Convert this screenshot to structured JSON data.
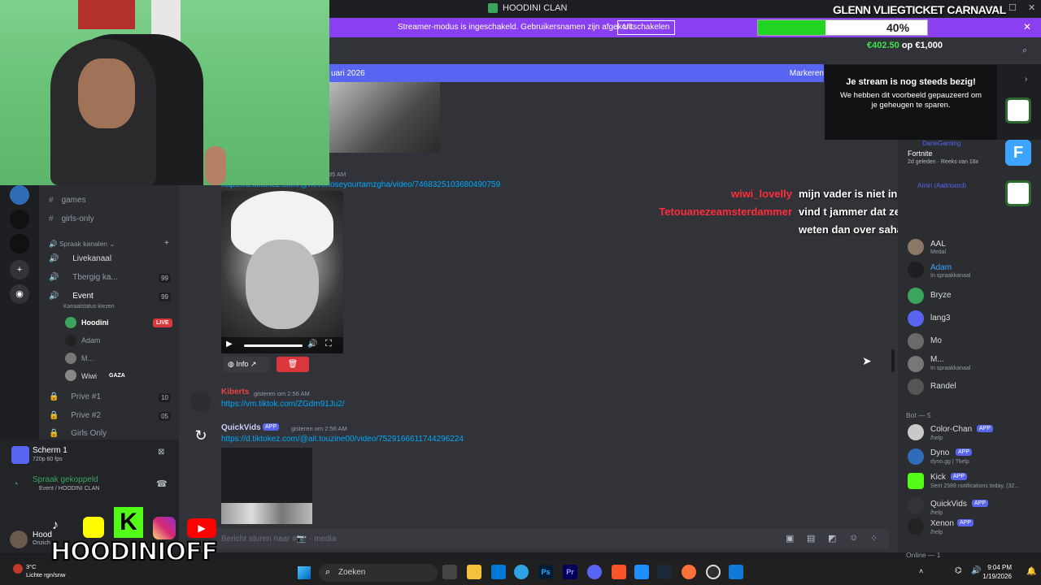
{
  "window": {
    "title": "HOODINI CLAN"
  },
  "banner": {
    "text": "Streamer-modus is ingeschakeld. Gebruikersnamen zijn afgekort.",
    "button": "Uitschakelen"
  },
  "goal": {
    "title": "GLENN VLIEGTICKET CARNAVAL",
    "percent_label": "40%",
    "progress": 0.4,
    "raised": "€402.50",
    "of": "op €1,000",
    "fill_color": "#22d422"
  },
  "stream_paused": {
    "title": "Je stream is nog steeds bezig!",
    "body": "We hebben dit voorbeeld gepauzeerd om je geheugen te sparen."
  },
  "event_bar": {
    "date": "uari 2026",
    "action": "Markeren"
  },
  "channels": {
    "text": [
      {
        "name": "games"
      },
      {
        "name": "girls-only"
      }
    ],
    "voice_header": "Spraak kanalen",
    "voice": [
      {
        "name": "Livekanaal"
      },
      {
        "name": "Tbergig ka...",
        "a": "00",
        "b": "99"
      },
      {
        "name": "Event",
        "a": "04",
        "b": "99",
        "status": "Kanaalstatus kiezen"
      }
    ],
    "event_members": [
      {
        "name": "Hoodini",
        "badge": "LIVE"
      },
      {
        "name": "Adam"
      },
      {
        "name": "M..."
      },
      {
        "name": "Wiwi",
        "tag": "GAZA"
      }
    ],
    "more": [
      {
        "name": "Prive #1",
        "a": "00",
        "b": "10"
      },
      {
        "name": "Prive #2",
        "a": "00",
        "b": "05"
      },
      {
        "name": "Girls Only"
      }
    ]
  },
  "screen_share": {
    "title": "Scherm 1",
    "sub": "720p 60 fps"
  },
  "voice_connected": {
    "title": "Spraak gekoppeld",
    "sub": "Event / HOODINI CLAN"
  },
  "user": {
    "name": "Hood",
    "status": "Onzich"
  },
  "messages": {
    "time_top": "85 AM",
    "link1": "https://d.tiktokez.com/@neverloseyourtamzgha/video/7468325103680490759",
    "video_info_label": "Info",
    "msg2": {
      "author": "Kiberts",
      "time": "gisteren om 2:56 AM",
      "link": "https://vm.tiktok.com/ZGdm91Ju2/"
    },
    "msg3": {
      "author": "QuickVids",
      "badge": "APP",
      "time": "gisteren om 2:56 AM",
      "link": "https://d.tiktokez.com/@ait.touzine00/video/7529166611744296224"
    },
    "composer_placeholder": "Bericht sturen naar #📷 · media"
  },
  "overlay_chat": [
    {
      "name": "wiwi_lovelly",
      "color": "#ff2d3a",
      "msg": "mijn vader is niet in de rif opgegroeid"
    },
    {
      "name": "Tetouanezeamsterdammer",
      "color": "#ff2d3a",
      "msg": "vind t jammer dat ze meer over El Khattabi"
    },
    {
      "name": "",
      "color": "#ff2d3a",
      "msg": "weten dan over sahabaa"
    }
  ],
  "activity": [
    {
      "name": "DaneGaming",
      "game": "Fortnite",
      "meta": "2d geleden · Reeks van 18x"
    },
    {
      "name": "Amin (Aaitnoord)"
    }
  ],
  "members": [
    {
      "name": "AAL",
      "sub": "Medal"
    },
    {
      "name": "Adam",
      "sub": "In spraakkanaal",
      "color": "#3ba6ff"
    },
    {
      "name": "Bryze"
    },
    {
      "name": "lang3"
    },
    {
      "name": "Mo"
    },
    {
      "name": "M...",
      "sub": "In spraakkanaal"
    },
    {
      "name": "Randel"
    }
  ],
  "bots_header": "Bot — 5",
  "bots": [
    {
      "name": "Color-Chan",
      "badge": "APP",
      "sub": "/help"
    },
    {
      "name": "Dyno",
      "badge": "APP",
      "sub": "dyno.gg | ?help"
    },
    {
      "name": "Kick",
      "badge": "APP",
      "sub": "Sent 2589 notifications today, (32..."
    },
    {
      "name": "QuickVids",
      "badge": "APP",
      "sub": "/help"
    },
    {
      "name": "Xenon",
      "badge": "APP",
      "sub": "/help"
    }
  ],
  "online_header": "Online — 1",
  "taskbar": {
    "weather_temp": "3°C",
    "weather_desc": "Lichte rgn/snw",
    "search": "Zoeken",
    "time": "9:04 PM",
    "date": "1/19/2026"
  },
  "brand": "HOODINIOFF"
}
